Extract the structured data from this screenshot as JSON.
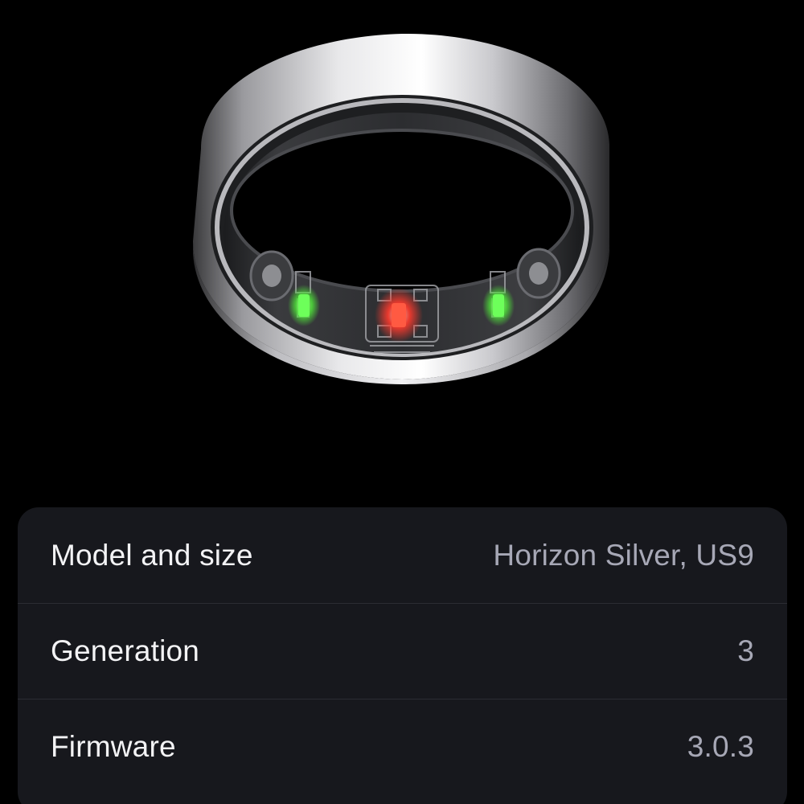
{
  "hero": {
    "image": "oura-ring-product-icon"
  },
  "device_info": {
    "rows": [
      {
        "label": "Model and size",
        "value": "Horizon Silver, US9"
      },
      {
        "label": "Generation",
        "value": "3"
      },
      {
        "label": "Firmware",
        "value": "3.0.3"
      }
    ]
  },
  "colors": {
    "background": "#000000",
    "card": "#17181d",
    "label_text": "#f3f3f5",
    "value_text": "#a7a8b6",
    "sensor_green": "#6dff5a",
    "sensor_red": "#ff3b2e"
  }
}
